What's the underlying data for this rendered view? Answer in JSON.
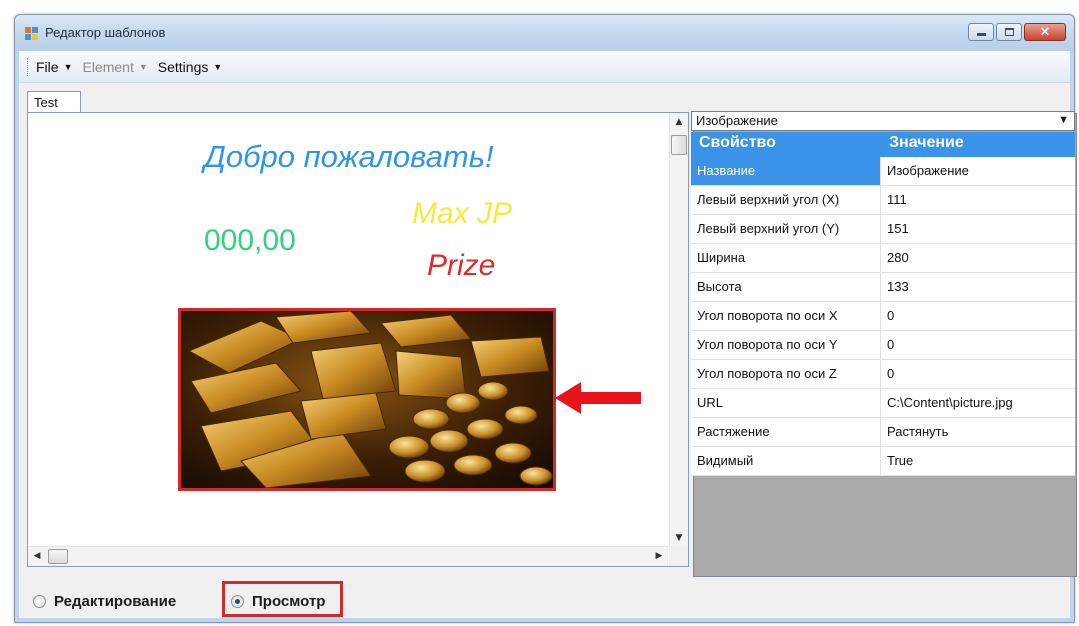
{
  "window": {
    "title": "Редактор шаблонов",
    "controls": {
      "minimize": "minimize",
      "maximize": "maximize",
      "close": "×"
    }
  },
  "menu": {
    "items": [
      {
        "label": "File",
        "enabled": true
      },
      {
        "label": "Element",
        "enabled": false
      },
      {
        "label": "Settings",
        "enabled": true
      }
    ]
  },
  "tabs": [
    {
      "label": "Test"
    }
  ],
  "canvas": {
    "welcome_text": "Добро пожаловать!",
    "score_text": "000,00",
    "maxjp_text": "Max JP",
    "prize_text": "Prize",
    "colors": {
      "welcome": "#2f95e8",
      "score": "#33d17a",
      "maxjp": "#f4ea3e",
      "prize": "#e02a2a",
      "highlight": "#cf2b2b"
    },
    "image_icon": "gold-bars-and-coins-picture",
    "arrow_icon": "red-arrow-left-icon"
  },
  "properties": {
    "object_selector": "Изображение",
    "header": {
      "property": "Свойство",
      "value": "Значение"
    },
    "rows": [
      {
        "name": "Название",
        "value": "Изображение",
        "selected": true
      },
      {
        "name": "Левый верхний угол (X)",
        "value": "111"
      },
      {
        "name": "Левый верхний угол (Y)",
        "value": "151"
      },
      {
        "name": "Ширина",
        "value": "280"
      },
      {
        "name": "Высота",
        "value": "133"
      },
      {
        "name": "Угол поворота по оси X",
        "value": "0"
      },
      {
        "name": "Угол поворота по оси Y",
        "value": "0"
      },
      {
        "name": "Угол поворота по оси Z",
        "value": "0"
      },
      {
        "name": "URL",
        "value": "C:\\Content\\picture.jpg"
      },
      {
        "name": "Растяжение",
        "value": "Растянуть"
      },
      {
        "name": "Видимый",
        "value": "True"
      }
    ]
  },
  "mode": {
    "edit_label": "Редактирование",
    "view_label": "Просмотр",
    "selected": "view"
  }
}
